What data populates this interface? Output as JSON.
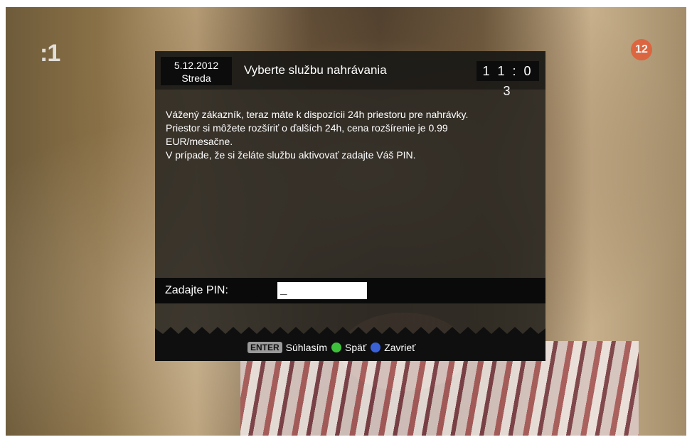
{
  "channel": {
    "logo": ":1",
    "age_rating": "12"
  },
  "dialog": {
    "date": "5.12.2012",
    "weekday": "Streda",
    "title": "Vyberte službu nahrávania",
    "time": "1 1 : 0 3",
    "message_lines": [
      "Vážený zákazník, teraz máte k dispozícii 24h priestoru pre nahrávky.",
      "Priestor si môžete rozšíriť o ďalších 24h, cena rozšírenie je 0.99",
      "EUR/mesačne.",
      "V prípade, že si želáte službu aktivovať zadajte Váš PIN."
    ],
    "pin_label": "Zadajte PIN:",
    "pin_value": "_"
  },
  "footer": {
    "enter_key": "ENTER",
    "enter_label": "Súhlasím",
    "green_label": "Späť",
    "blue_label": "Zavrieť"
  },
  "colors": {
    "green_button": "#3ec13a",
    "blue_button": "#3a62d6",
    "age_badge": "#e0603a"
  }
}
